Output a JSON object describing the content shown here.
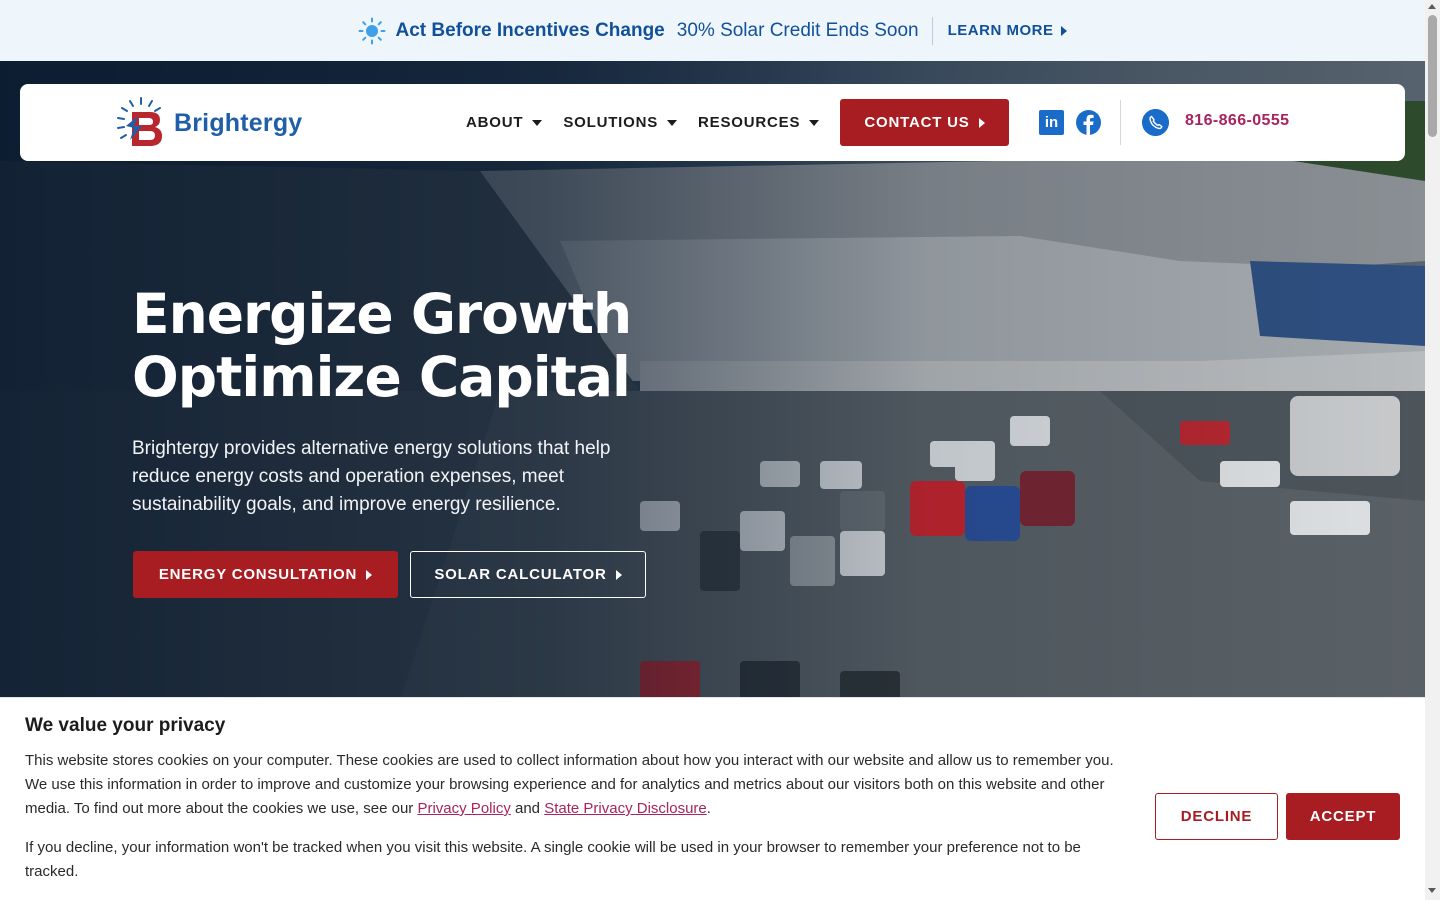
{
  "announcement": {
    "headline": "Act Before Incentives Change",
    "subtext": "30% Solar Credit Ends Soon",
    "link_label": "LEARN MORE",
    "icon": "sun-icon"
  },
  "header": {
    "logo_text": "Brightergy",
    "nav": [
      {
        "label": "ABOUT"
      },
      {
        "label": "SOLUTIONS"
      },
      {
        "label": "RESOURCES"
      }
    ],
    "contact_label": "CONTACT US",
    "social": [
      {
        "name": "linkedin-icon",
        "glyph": "in"
      },
      {
        "name": "facebook-icon"
      }
    ],
    "phone": "816-866-0555"
  },
  "hero": {
    "title_line1": "Energize Growth",
    "title_line2": "Optimize Capital",
    "description": "Brightergy provides alternative energy solutions that help reduce energy costs and operation expenses, meet sustainability goals, and improve energy resilience.",
    "primary_button": "ENERGY CONSULTATION",
    "secondary_button": "SOLAR CALCULATOR"
  },
  "cookie": {
    "title": "We value your privacy",
    "para1_before": "This website stores cookies on your computer. These cookies are used to collect information about how you interact with our website and allow us to remember you. We use this information in order to improve and customize your browsing experience and for analytics and metrics about our visitors both on this website and other media. To find out more about the cookies we use, see our ",
    "privacy_link": "Privacy Policy",
    "para1_and": " and ",
    "state_link": "State Privacy Disclosure",
    "para1_end": ".",
    "para2": "If you decline, your information won't be tracked when you visit this website. A single cookie will be used in your browser to remember your preference not to be tracked.",
    "decline_label": "DECLINE",
    "accept_label": "ACCEPT"
  },
  "colors": {
    "brand_red": "#a71d22",
    "brand_blue": "#1f5ea8",
    "announce_bg": "#eef6fc",
    "link_magenta": "#a8245f"
  }
}
